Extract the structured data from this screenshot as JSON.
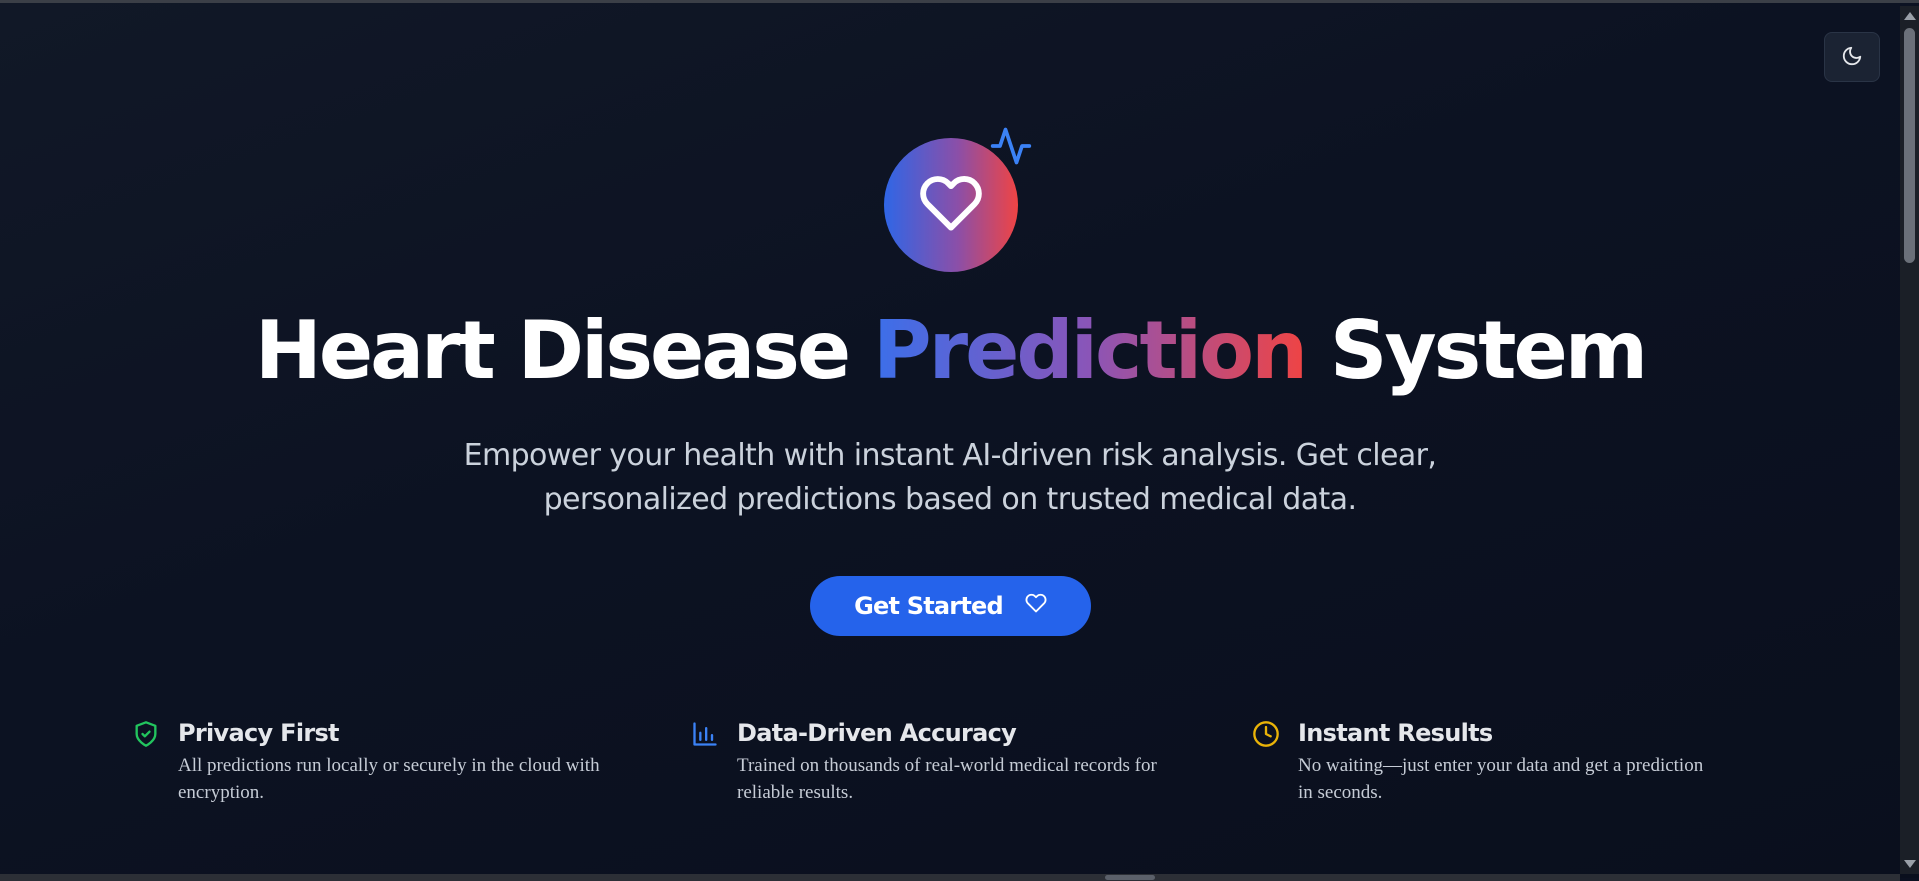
{
  "header": {
    "theme_toggle_icon": "moon-icon"
  },
  "hero": {
    "logo_icon": "heart-icon",
    "logo_badge_icon": "activity-pulse-icon",
    "title_part1": "Heart Disease ",
    "title_highlight": "Prediction",
    "title_part2": " System",
    "subtitle_line1": "Empower your health with instant AI-driven risk analysis. Get clear,",
    "subtitle_line2": "personalized predictions based on trusted medical data.",
    "cta_label": "Get Started",
    "cta_icon": "heart-icon"
  },
  "features": [
    {
      "icon": "shield-check-icon",
      "icon_color": "#22c55e",
      "title": "Privacy First",
      "desc_line1": "All predictions run locally or securely in the cloud with",
      "desc_line2": "encryption."
    },
    {
      "icon": "bar-chart-icon",
      "icon_color": "#3b82f6",
      "title": "Data-Driven Accuracy",
      "desc_line1": "Trained on thousands of real-world medical records for",
      "desc_line2": "reliable results."
    },
    {
      "icon": "clock-icon",
      "icon_color": "#eab308",
      "title": "Instant Results",
      "desc_line1": "No waiting—just enter your data and get a prediction",
      "desc_line2": "in seconds."
    }
  ],
  "colors": {
    "background": "#0b1020",
    "accent": "#2563eb",
    "gradient_start": "#3b6fea",
    "gradient_end": "#ef4444"
  }
}
